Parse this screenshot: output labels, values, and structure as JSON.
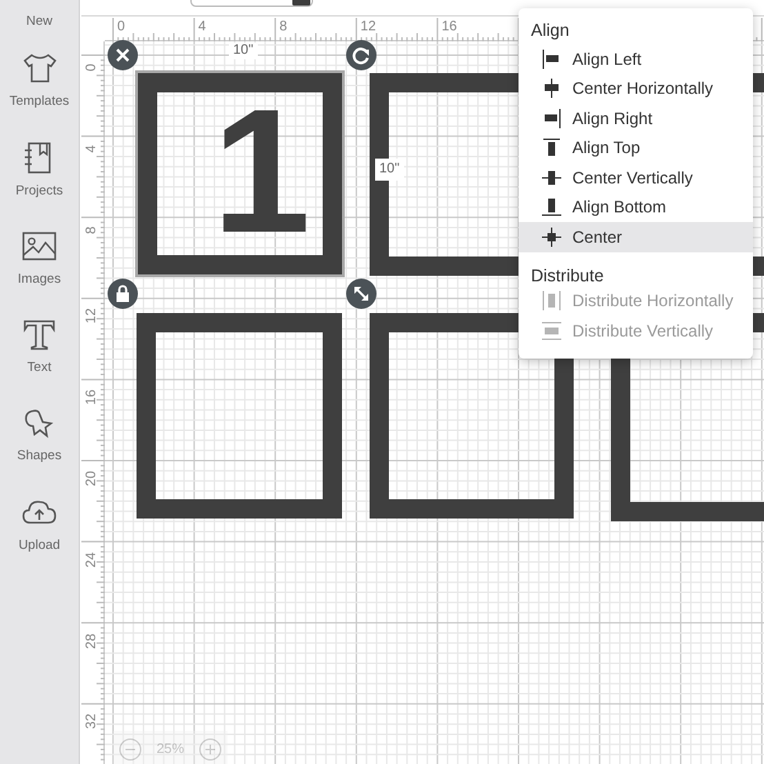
{
  "sidebar": {
    "items": [
      {
        "label": "New"
      },
      {
        "label": "Templates"
      },
      {
        "label": "Projects"
      },
      {
        "label": "Images"
      },
      {
        "label": "Text"
      },
      {
        "label": "Shapes"
      },
      {
        "label": "Upload"
      }
    ]
  },
  "rulers": {
    "horizontal": [
      "0",
      "4",
      "8",
      "12",
      "16"
    ],
    "vertical": [
      "0",
      "4",
      "8",
      "12",
      "16",
      "20",
      "24",
      "28",
      "32"
    ]
  },
  "canvas": {
    "shapes": [
      {
        "kind": "square",
        "selected": true,
        "text": "1"
      },
      {
        "kind": "square",
        "selected": false
      },
      {
        "kind": "square",
        "selected": false
      },
      {
        "kind": "square",
        "selected": false
      },
      {
        "kind": "square",
        "selected": false
      },
      {
        "kind": "square",
        "selected": false
      }
    ],
    "width_label": "10\"",
    "height_label": "10\""
  },
  "zoom": {
    "level_label": "25%"
  },
  "align_menu": {
    "sections": [
      {
        "title": "Align",
        "items": [
          {
            "label": "Align Left",
            "selected": false,
            "disabled": false
          },
          {
            "label": "Center Horizontally",
            "selected": false,
            "disabled": false
          },
          {
            "label": "Align Right",
            "selected": false,
            "disabled": false
          },
          {
            "label": "Align Top",
            "selected": false,
            "disabled": false
          },
          {
            "label": "Center Vertically",
            "selected": false,
            "disabled": false
          },
          {
            "label": "Align Bottom",
            "selected": false,
            "disabled": false
          },
          {
            "label": "Center",
            "selected": true,
            "disabled": false
          }
        ]
      },
      {
        "title": "Distribute",
        "items": [
          {
            "label": "Distribute Horizontally",
            "selected": false,
            "disabled": true
          },
          {
            "label": "Distribute Vertically",
            "selected": false,
            "disabled": true
          }
        ]
      }
    ]
  }
}
